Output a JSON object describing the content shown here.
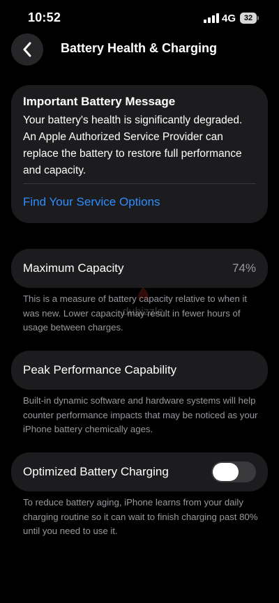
{
  "status_bar": {
    "time": "10:52",
    "network": "4G",
    "battery_level": "32",
    "signal_bars": 4
  },
  "header": {
    "title": "Battery Health & Charging",
    "back_icon": "chevron-left-icon"
  },
  "message_card": {
    "title": "Important Battery Message",
    "body": "Your battery's health is significantly degraded. An Apple Authorized Service Provider can replace the battery to restore full performance and capacity.",
    "link_label": "Find Your Service Options",
    "link_color": "#2f8cff"
  },
  "max_capacity": {
    "label": "Maximum Capacity",
    "value": "74%",
    "description": "This is a measure of battery capacity relative to when it was new. Lower capacity may result in fewer hours of usage between charges."
  },
  "peak_performance": {
    "label": "Peak Performance Capability",
    "description": "Built-in dynamic software and hardware systems will help counter performance impacts that may be noticed as your iPhone battery chemically ages."
  },
  "optimized_charging": {
    "label": "Optimized Battery Charging",
    "toggle_on": false,
    "description": "To reduce battery aging, iPhone learns from your daily charging routine so it can wait to finish charging past 80% until you need to use it."
  },
  "colors": {
    "background": "#000000",
    "card": "#1c1c1e",
    "secondary_text": "#98989e",
    "accent": "#2f8cff"
  }
}
